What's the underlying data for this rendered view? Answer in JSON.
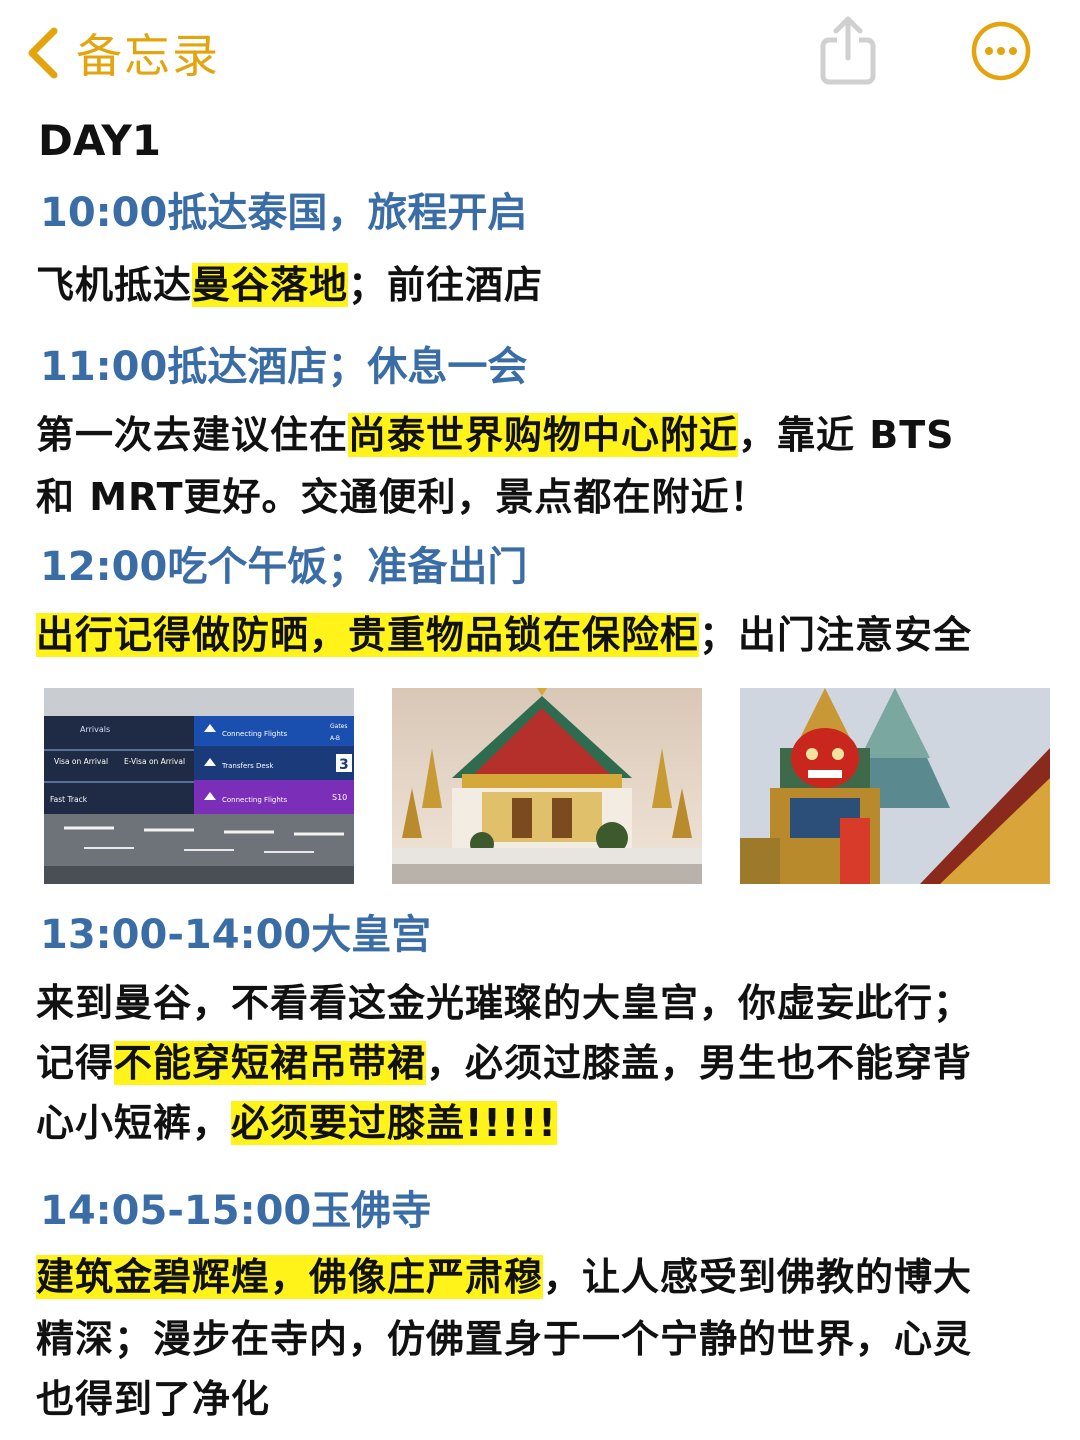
{
  "nav": {
    "back_label": "备忘录",
    "accent_color": "#e3a40e",
    "icons": [
      "chevron-left-icon",
      "share-icon",
      "more-icon"
    ]
  },
  "note": {
    "day": "DAY1",
    "s1": {
      "time": "10:00抵达泰国，旅程开启",
      "p1_a": "飞机抵达",
      "p1_hl": "曼谷落地",
      "p1_b": "；前往酒店"
    },
    "s2": {
      "time": "11:00抵达酒店；休息一会",
      "p1_a": "第一次去建议住在",
      "p1_hl": "尚泰世界购物中心附近",
      "p1_b": "，靠近 BTS",
      "p2": "和 MRT更好。交通便利，景点都在附近！"
    },
    "s3": {
      "time": "12:00吃个午饭；准备出门",
      "p1_hl": "出行记得做防晒，贵重物品锁在保险柜",
      "p1_b": "；出门注意安全"
    },
    "photos": [
      {
        "name": "airport-sign-photo",
        "sign_lines": [
          "Arrivals",
          "Visa on Arrival",
          "E-Visa on Arrival",
          "Fast Track",
          "Connecting Flights",
          "Transfers Desk",
          "Connecting Flights",
          "Gates",
          "A-B",
          "3",
          "S10"
        ]
      },
      {
        "name": "grand-palace-photo"
      },
      {
        "name": "temple-guardian-photo"
      }
    ],
    "s4": {
      "time": "13:00-14:00大皇宫",
      "p1": "来到曼谷，不看看这金光璀璨的大皇宫，你虚妄此行；",
      "p2_a": "记得",
      "p2_hl": "不能穿短裙吊带裙",
      "p2_b": "，必须过膝盖，男生也不能穿背",
      "p3_a": "心小短裤，",
      "p3_hl": "必须要过膝盖!!!!!"
    },
    "s5": {
      "time": "14:05-15:00玉佛寺",
      "p1_hl": "建筑金碧辉煌，佛像庄严肃穆",
      "p1_b": "，让人感受到佛教的博大",
      "p2": "精深；漫步在寺内，仿佛置身于一个宁静的世界，心灵",
      "p3": "也得到了净化"
    }
  },
  "colors": {
    "time_heading": "#3a6da6",
    "highlight": "#fff31a",
    "body_text": "#111111"
  }
}
